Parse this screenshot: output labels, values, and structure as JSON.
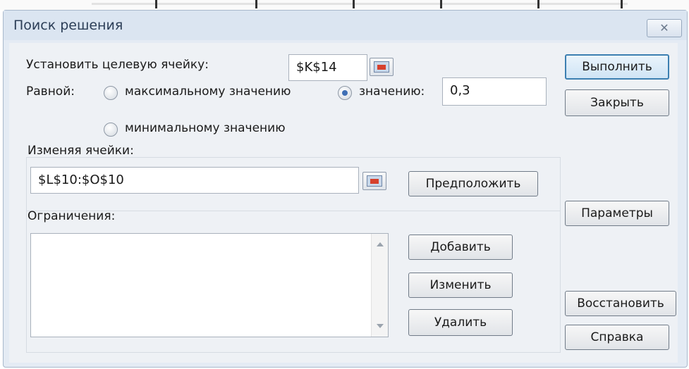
{
  "window": {
    "title": "Поиск решения",
    "close_glyph": "✕"
  },
  "target": {
    "label": "Установить целевую ячейку:",
    "value": "$K$14"
  },
  "equal": {
    "label": "Равной:",
    "options": [
      {
        "label": "максимальному значению",
        "selected": false
      },
      {
        "label": "минимальному значению",
        "selected": false
      },
      {
        "label": "значению:",
        "selected": true
      }
    ],
    "value": "0,3"
  },
  "changing": {
    "label": "Изменяя ячейки:",
    "value": "$L$10:$O$10",
    "guess_label": "Предположить"
  },
  "constraints": {
    "label": "Ограничения:",
    "items": [],
    "add_label": "Добавить",
    "change_label": "Изменить",
    "delete_label": "Удалить"
  },
  "side": {
    "run_label": "Выполнить",
    "close_label": "Закрыть",
    "options_label": "Параметры",
    "reset_label": "Восстановить",
    "help_label": "Справка"
  },
  "icons": {
    "ref": "collapse-dialog-icon",
    "scroll_up": "scroll-up-arrow-icon",
    "scroll_down": "scroll-down-arrow-icon"
  },
  "colors": {
    "accent": "#3c7fb1",
    "radio_dot": "#3f6fb5",
    "dialog_bg": "#eef1f5"
  }
}
